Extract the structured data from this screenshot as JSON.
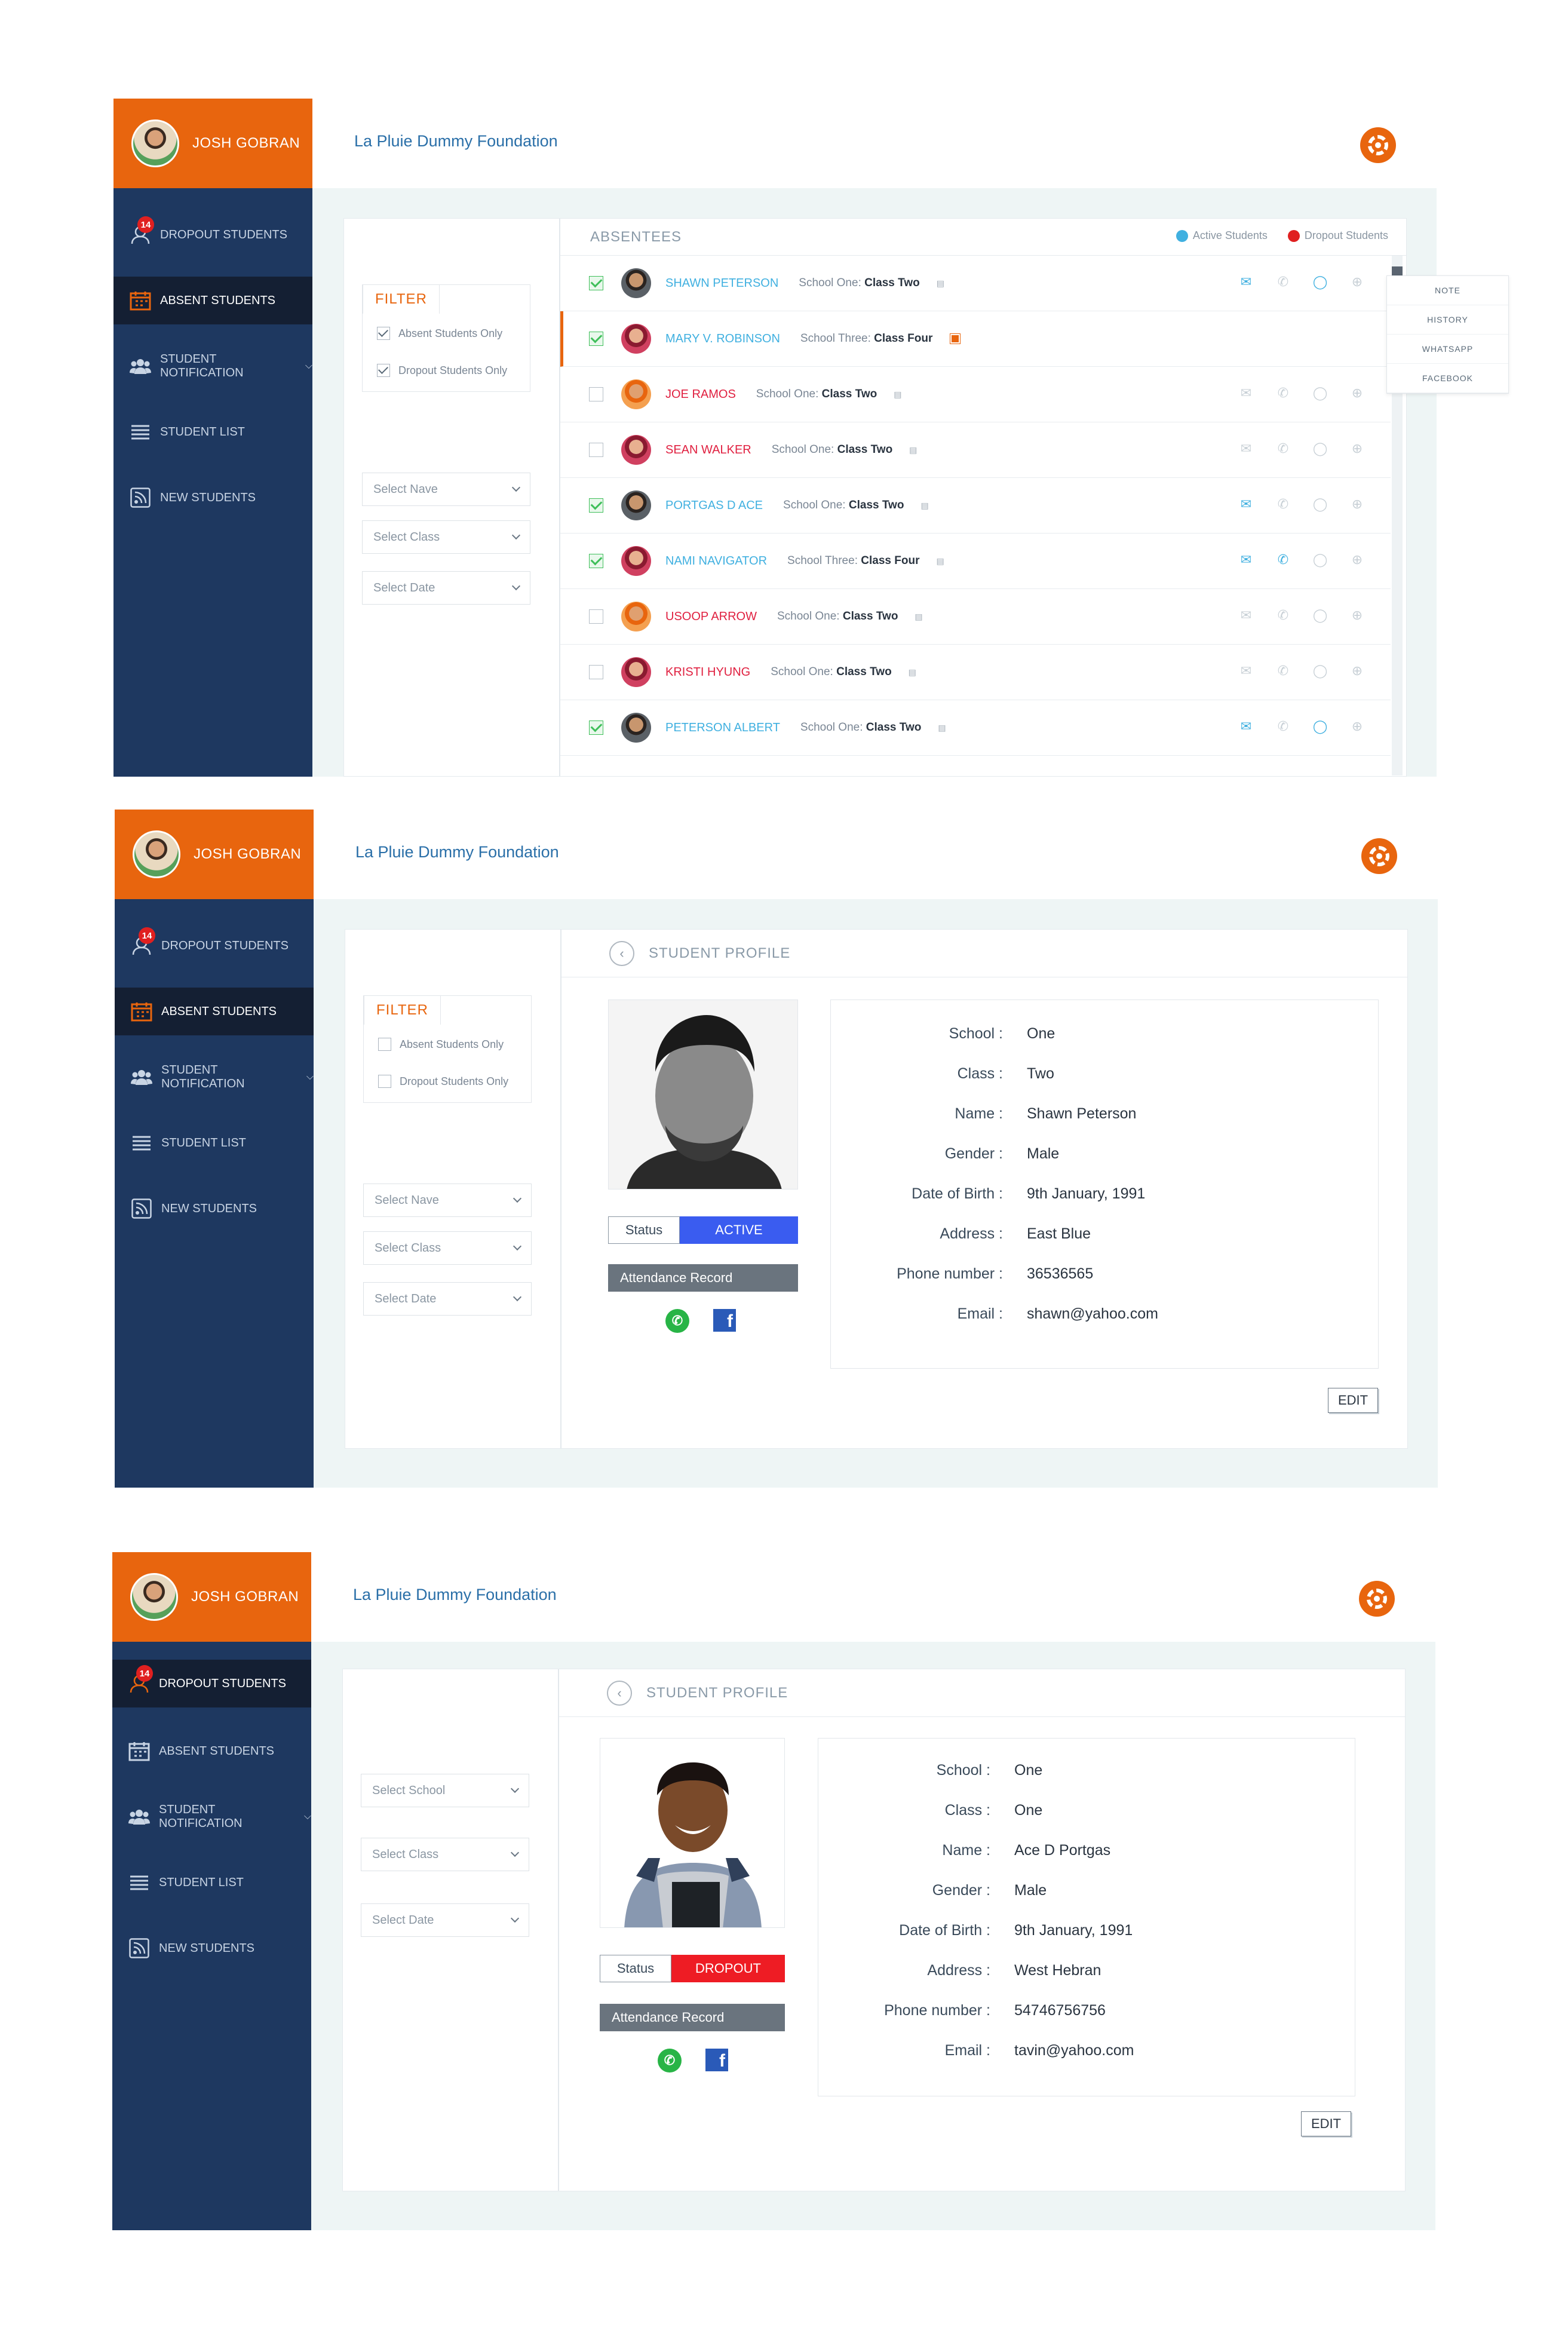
{
  "user": {
    "name": "JOSH GOBRAN"
  },
  "org": "La Pluie Dummy Foundation",
  "nav": {
    "dropout": "DROPOUT STUDENTS",
    "dropout_badge": "14",
    "absent": "ABSENT STUDENTS",
    "notification": "STUDENT NOTIFICATION",
    "list": "STUDENT LIST",
    "new": "NEW STUDENTS"
  },
  "filter": {
    "title": "FILTER",
    "absent_only": "Absent Students Only",
    "dropout_only": "Dropout Students Only",
    "select_name": "Select Nave",
    "select_class": "Select Class",
    "select_date": "Select Date",
    "select_school": "Select School"
  },
  "absentees": {
    "title": "ABSENTEES",
    "legend_active": "Active Students",
    "legend_dropout": "Dropout Students",
    "active_color": "#40b0e0",
    "dropout_color": "#e02020",
    "rows": [
      {
        "name": "SHAWN PETERSON",
        "school": "School One:",
        "class": "Class Two",
        "checked": true,
        "status": "active"
      },
      {
        "name": "MARY V. ROBINSON",
        "school": "School Three:",
        "class": "Class Four",
        "checked": true,
        "status": "active"
      },
      {
        "name": "JOE RAMOS",
        "school": "School One:",
        "class": "Class Two",
        "checked": false,
        "status": "dropout"
      },
      {
        "name": "SEAN WALKER",
        "school": "School One:",
        "class": "Class Two",
        "checked": false,
        "status": "dropout"
      },
      {
        "name": "PORTGAS D ACE",
        "school": "School One:",
        "class": "Class Two",
        "checked": true,
        "status": "active"
      },
      {
        "name": "NAMI NAVIGATOR",
        "school": "School Three:",
        "class": "Class Four",
        "checked": true,
        "status": "active"
      },
      {
        "name": "USOOP ARROW",
        "school": "School One:",
        "class": "Class Two",
        "checked": false,
        "status": "dropout"
      },
      {
        "name": "KRISTI HYUNG",
        "school": "School One:",
        "class": "Class Two",
        "checked": false,
        "status": "dropout"
      },
      {
        "name": "PETERSON ALBERT",
        "school": "School One:",
        "class": "Class Two",
        "checked": true,
        "status": "active"
      }
    ],
    "menu": [
      "NOTE",
      "HISTORY",
      "WHATSAPP",
      "FACEBOOK"
    ]
  },
  "profile1": {
    "title": "STUDENT PROFILE",
    "status_label": "Status",
    "status_value": "ACTIVE",
    "status_color": "#3a5cf0",
    "attendance": "Attendance Record",
    "edit": "EDIT",
    "labels": [
      "School :",
      "Class :",
      "Name :",
      "Gender :",
      "Date of Birth :",
      "Address :",
      "Phone number :",
      "Email :"
    ],
    "values": [
      "One",
      "Two",
      "Shawn Peterson",
      "Male",
      "9th January, 1991",
      "East Blue",
      "36536565",
      "shawn@yahoo.com"
    ]
  },
  "profile2": {
    "title": "STUDENT PROFILE",
    "status_label": "Status",
    "status_value": "DROPOUT",
    "status_color": "#ee1c24",
    "attendance": "Attendance Record",
    "edit": "EDIT",
    "labels": [
      "School :",
      "Class :",
      "Name :",
      "Gender :",
      "Date of Birth :",
      "Address :",
      "Phone number :",
      "Email :"
    ],
    "values": [
      "One",
      "One",
      "Ace D Portgas",
      "Male",
      "9th January, 1991",
      "West Hebran",
      "54746756756",
      "tavin@yahoo.com"
    ]
  }
}
